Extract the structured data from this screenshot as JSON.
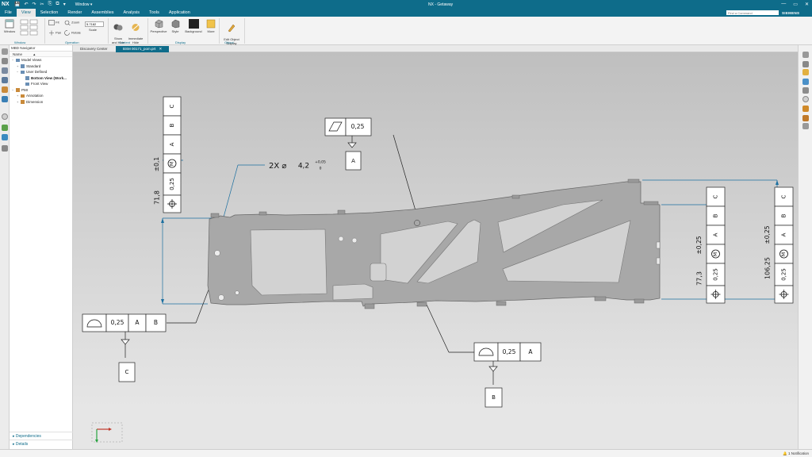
{
  "app": {
    "logo": "NX",
    "window_menu": "Window ▾",
    "title": "NX - Getaway",
    "brand": "SIEMENS",
    "search_placeholder": "Find a Command",
    "window_controls": [
      "—",
      "▭",
      "✕"
    ]
  },
  "quick_access": [
    "💾",
    "↶",
    "↷",
    "✂",
    "⎘",
    "⧉",
    "▾"
  ],
  "menu": [
    "File",
    "View",
    "Selection",
    "Render",
    "Assemblies",
    "Analysis",
    "Tools",
    "Application"
  ],
  "menu_active": "View",
  "ribbon": {
    "window_btn": "Window",
    "fit": "Fit",
    "zoom": "Zoom",
    "pan": "Pan",
    "rotate": "Rotate",
    "scale_value": "5.7182",
    "scale_label": "Scale",
    "show_hide": "Show\nand Hide",
    "immediate_hide": "Immediate\nHide",
    "perspective": "Perspective",
    "style": "Style",
    "background": "Background",
    "more": "More",
    "edit_object_display": "Edit Object\nDisplay",
    "groups": {
      "window": "Window",
      "operation": "Operation",
      "content": "Content",
      "display": "Display",
      "object": "Object"
    }
  },
  "navigator": {
    "title": "MBD Navigator",
    "column": "Name",
    "sort_icon": "▲",
    "tree": [
      {
        "label": "Model Views",
        "level": 0,
        "exp": "−",
        "color": "#6a8fb5"
      },
      {
        "label": "Standard",
        "level": 1,
        "exp": "+",
        "color": "#6a8fb5"
      },
      {
        "label": "User Defined",
        "level": 1,
        "exp": "−",
        "color": "#6a8fb5"
      },
      {
        "label": "Bottom View (Work...",
        "level": 2,
        "exp": "",
        "color": "#6a8fb5",
        "bold": true
      },
      {
        "label": "Front View",
        "level": 2,
        "exp": "",
        "color": "#6a8fb5"
      },
      {
        "label": "PMI",
        "level": 0,
        "exp": "−",
        "color": "#c98a3a"
      },
      {
        "label": "Annotation",
        "level": 1,
        "exp": "+",
        "color": "#c98a3a"
      },
      {
        "label": "Dimension",
        "level": 1,
        "exp": "+",
        "color": "#c98a3a"
      }
    ],
    "dependencies": "Dependencies",
    "details": "Details"
  },
  "tabs": [
    {
      "label": "Discovery Center",
      "active": false
    },
    {
      "label": "BSM 00171_pom.prt",
      "active": true
    }
  ],
  "pmi": {
    "hole_note": "2X ⌀",
    "hole_value": "4,2",
    "hole_tol_upper": "+0,05",
    "hole_tol_lower": "0",
    "flatness_value": "0,25",
    "flatness_datum": "A",
    "left_fcf": {
      "value": "0,25",
      "datums": [
        "A",
        "B"
      ],
      "datum_flag": "C"
    },
    "bottom_fcf": {
      "value": "0,25",
      "datum": "A",
      "datum_flag": "B"
    },
    "left_position": {
      "value": "0,25",
      "datums": [
        "A",
        "B",
        "C"
      ],
      "modifier": "M"
    },
    "left_dim": {
      "value": "71,8",
      "tol": "±0,1"
    },
    "right1_position": {
      "value": "0,25",
      "datums": [
        "A",
        "B",
        "C"
      ],
      "modifier": "M"
    },
    "right1_dim": {
      "value": "77,3",
      "tol": "±0,25"
    },
    "right2_position": {
      "value": "0,25",
      "datums": [
        "A",
        "B",
        "C"
      ],
      "modifier": "M"
    },
    "right2_dim": {
      "value": "106,25",
      "tol": "±0,25"
    }
  },
  "status": {
    "notification": "1 Notification"
  },
  "colors": {
    "accent": "#0e6c8a",
    "part": "#a7a7a7",
    "leader": "#1b6fa0"
  }
}
